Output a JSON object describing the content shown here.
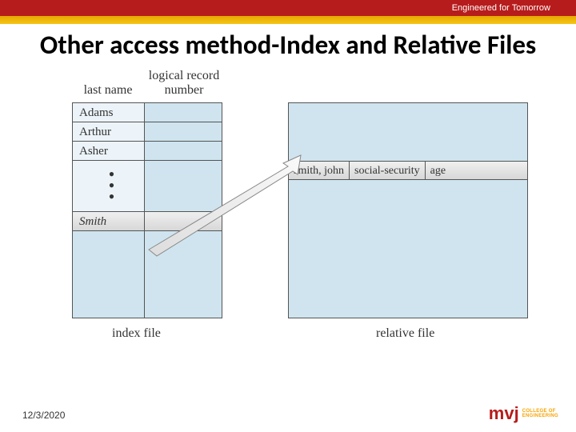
{
  "header": {
    "tagline": "Engineered for Tomorrow"
  },
  "title": "Other access method-Index and Relative Files",
  "diagram": {
    "headers": {
      "last_name": "last name",
      "logical_record": "logical record\nnumber"
    },
    "index_rows": [
      "Adams",
      "Arthur",
      "Asher"
    ],
    "index_smith": "Smith",
    "relative_record": {
      "name": "smith, john",
      "field2": "social-security",
      "field3": "age"
    },
    "captions": {
      "index": "index file",
      "relative": "relative file"
    }
  },
  "footer": {
    "date": "12/3/2020",
    "logo_text": "mvj",
    "logo_sub1": "COLLEGE OF",
    "logo_sub2": "ENGINEERING"
  }
}
